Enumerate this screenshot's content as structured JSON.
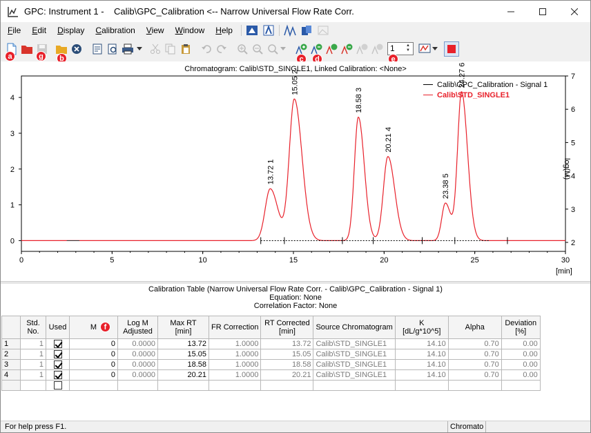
{
  "window": {
    "title": "GPC: Instrument 1 -    Calib\\GPC_Calibration <-- Narrow Universal Flow Rate Corr.",
    "controls": [
      "minimize-icon",
      "maximize-icon",
      "close-icon"
    ]
  },
  "menu": {
    "items": [
      {
        "key": "F",
        "rest": "ile"
      },
      {
        "key": "E",
        "rest": "dit"
      },
      {
        "key": "D",
        "rest": "isplay"
      },
      {
        "key": "C",
        "rest": "alibration"
      },
      {
        "key": "V",
        "rest": "iew"
      },
      {
        "key": "W",
        "rest": "indow"
      },
      {
        "key": "H",
        "rest": "elp"
      }
    ]
  },
  "toolbar": {
    "callouts": {
      "a": "a",
      "g": "g",
      "b": "b",
      "c": "c",
      "d": "d",
      "e": "e",
      "f": "f"
    },
    "signal_spin_value": "1",
    "colors": {
      "stop": "#e8202a",
      "callout": "#e8202a"
    }
  },
  "chart": {
    "title": "Chromatogram: Calib\\STD_SINGLE1, Linked Calibration: <None>",
    "xunit": "[min]",
    "right_axis_label": "log(M)",
    "legend": [
      {
        "label": "Calib\\GPC_Calibration - Signal 1",
        "color": "#000000"
      },
      {
        "label": "Calib\\STD_SINGLE1",
        "color": "#e8202a"
      }
    ],
    "peak_labels": [
      {
        "rt": "13.72",
        "num": "1"
      },
      {
        "rt": "15.05",
        "num": "2"
      },
      {
        "rt": "18.58",
        "num": "3"
      },
      {
        "rt": "20.21",
        "num": "4"
      },
      {
        "rt": "23.38",
        "num": "5"
      },
      {
        "rt": "24.27",
        "num": "6"
      }
    ]
  },
  "chart_data": {
    "type": "line",
    "title": "Chromatogram: Calib\\STD_SINGLE1, Linked Calibration: <None>",
    "xlabel": "[min]",
    "ylabel": "",
    "y2label": "log(M)",
    "xlim": [
      0,
      30
    ],
    "ylim": [
      -0.3,
      4.6
    ],
    "y2lim": [
      2,
      7
    ],
    "xticks": [
      0,
      5,
      10,
      15,
      20,
      25,
      30
    ],
    "yticks": [
      0,
      1,
      2,
      3,
      4
    ],
    "y2ticks": [
      2,
      3,
      4,
      5,
      6,
      7
    ],
    "grid": false,
    "legend_position": "top-right",
    "series": [
      {
        "name": "Calib\\STD_SINGLE1",
        "color": "#e8202a",
        "peaks": [
          {
            "rt": 13.72,
            "height": 1.45
          },
          {
            "rt": 15.05,
            "height": 3.95
          },
          {
            "rt": 18.58,
            "height": 3.45
          },
          {
            "rt": 20.21,
            "height": 2.35
          },
          {
            "rt": 23.38,
            "height": 1.05
          },
          {
            "rt": 24.27,
            "height": 4.15
          }
        ]
      }
    ]
  },
  "calibration": {
    "title": "Calibration Table (Narrow Universal Flow Rate Corr. - Calib\\GPC_Calibration - Signal 1)",
    "equation": "Equation: None",
    "correlation": "Correlation Factor: None",
    "headers": {
      "std_no": [
        "Std.",
        "No."
      ],
      "used": "Used",
      "m": "M",
      "logm": [
        "Log M",
        "Adjusted"
      ],
      "maxrt": [
        "Max RT",
        "[min]"
      ],
      "frcorr": "FR Correction",
      "rtcorr": [
        "RT Corrected",
        "[min]"
      ],
      "source": "Source Chromatogram",
      "k": [
        "K",
        "[dL/g*10^5]"
      ],
      "alpha": "Alpha",
      "dev": [
        "Deviation",
        "[%]"
      ]
    },
    "rows": [
      {
        "idx": "1",
        "std": "1",
        "used": true,
        "m": "0",
        "logm": "0.0000",
        "maxrt": "13.72",
        "fr": "1.0000",
        "rtc": "13.72",
        "src": "Calib\\STD_SINGLE1",
        "k": "14.10",
        "alpha": "0.70",
        "dev": "0.00"
      },
      {
        "idx": "2",
        "std": "1",
        "used": true,
        "m": "0",
        "logm": "0.0000",
        "maxrt": "15.05",
        "fr": "1.0000",
        "rtc": "15.05",
        "src": "Calib\\STD_SINGLE1",
        "k": "14.10",
        "alpha": "0.70",
        "dev": "0.00"
      },
      {
        "idx": "3",
        "std": "1",
        "used": true,
        "m": "0",
        "logm": "0.0000",
        "maxrt": "18.58",
        "fr": "1.0000",
        "rtc": "18.58",
        "src": "Calib\\STD_SINGLE1",
        "k": "14.10",
        "alpha": "0.70",
        "dev": "0.00"
      },
      {
        "idx": "4",
        "std": "1",
        "used": true,
        "m": "0",
        "logm": "0.0000",
        "maxrt": "20.21",
        "fr": "1.0000",
        "rtc": "20.21",
        "src": "Calib\\STD_SINGLE1",
        "k": "14.10",
        "alpha": "0.70",
        "dev": "0.00"
      }
    ]
  },
  "status": {
    "help": "For help press F1.",
    "pane": "Chromato"
  }
}
